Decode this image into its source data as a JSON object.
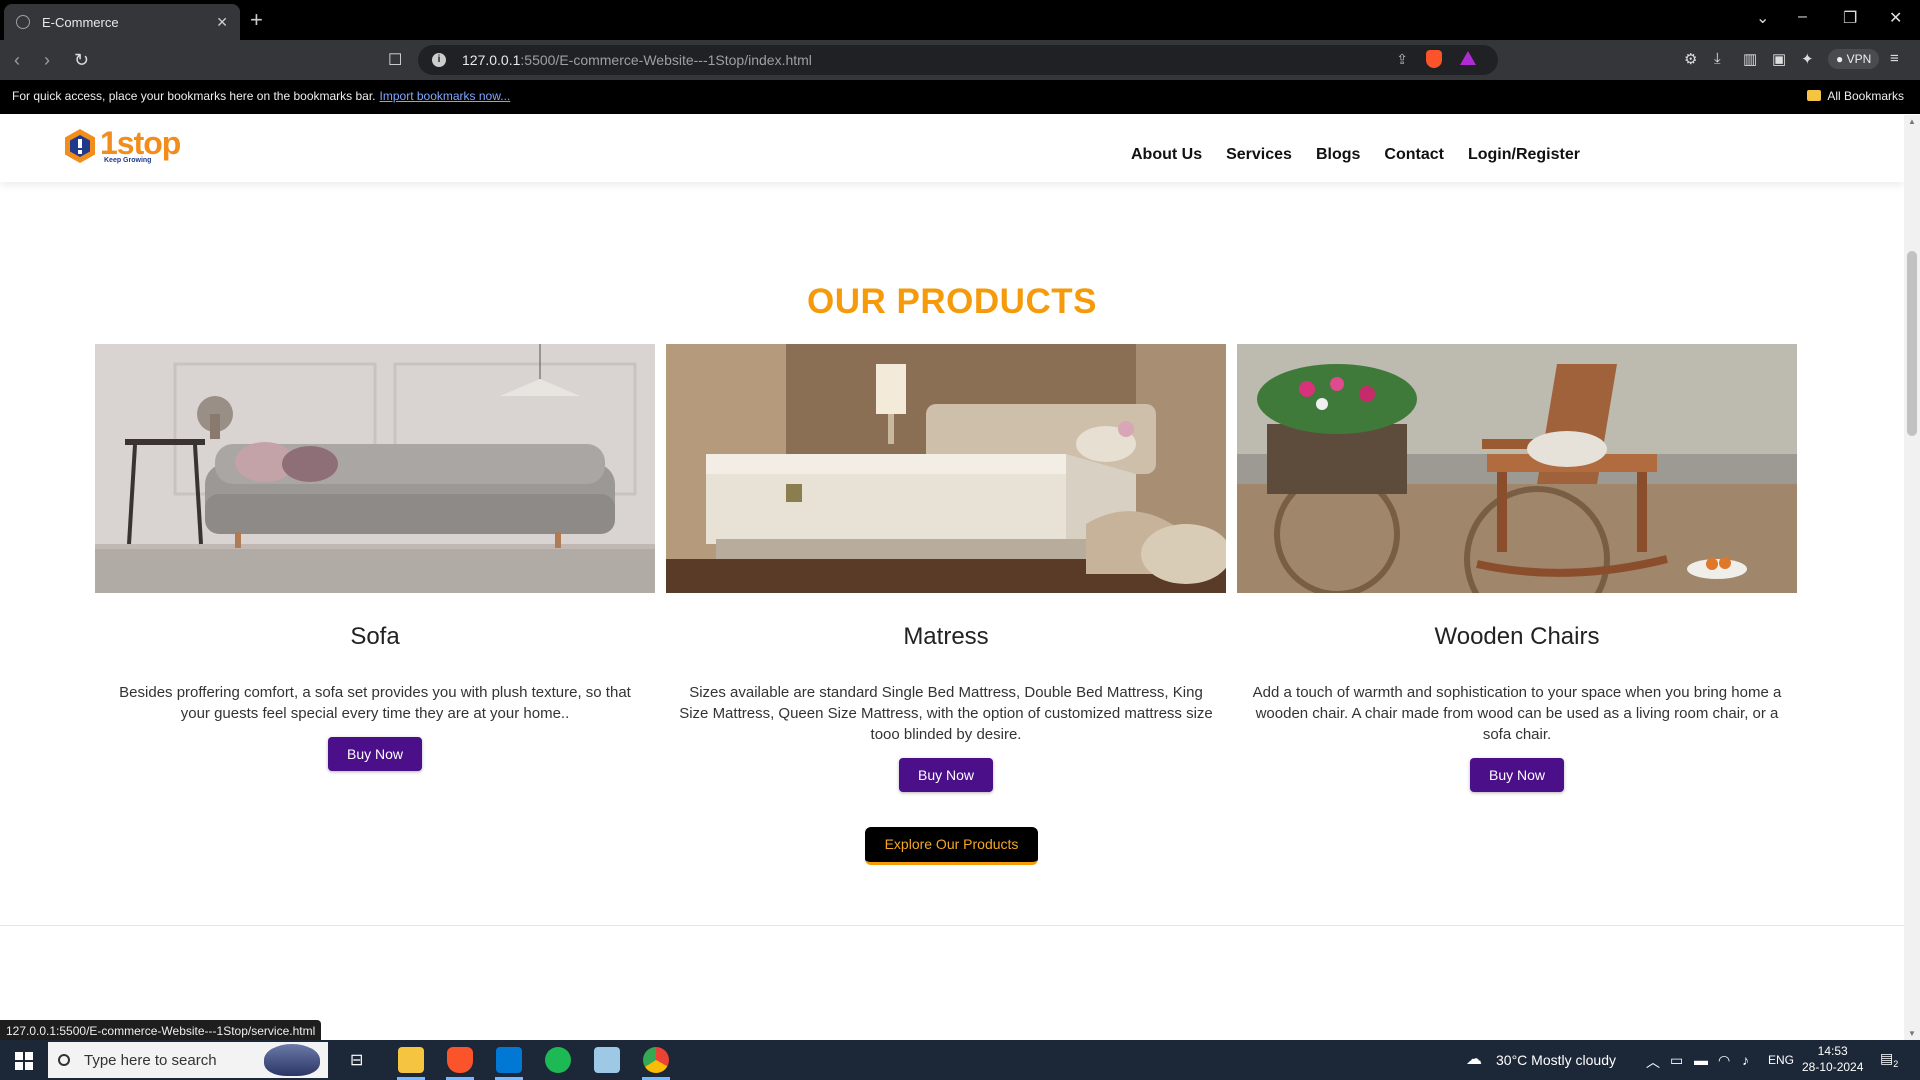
{
  "browser": {
    "tab_title": "E-Commerce",
    "close_glyph": "✕",
    "new_tab_glyph": "+",
    "url_host": "127.0.0.1",
    "url_rest": ":5500/E-commerce-Website---1Stop/index.html",
    "vpn_label": "VPN",
    "bookmarks_message": "For quick access, place your bookmarks here on the bookmarks bar.",
    "import_link": "Import bookmarks now...",
    "all_bookmarks": "All Bookmarks",
    "status_url": "127.0.0.1:5500/E-commerce-Website---1Stop/service.html"
  },
  "site": {
    "logo_text": "1stop",
    "logo_tagline": "Keep Growing",
    "nav": [
      "About Us",
      "Services",
      "Blogs",
      "Contact",
      "Login/Register"
    ],
    "section_title": "OUR PRODUCTS",
    "products": [
      {
        "name": "Sofa",
        "description": "Besides proffering comfort, a sofa set provides you with plush texture, so that your guests feel special every time they are at your home..",
        "button": "Buy Now"
      },
      {
        "name": "Matress",
        "description": "Sizes available are standard Single Bed Mattress, Double Bed Mattress, King Size Mattress, Queen Size Mattress, with the option of customized mattress size tooo blinded by desire.",
        "button": "Buy Now"
      },
      {
        "name": "Wooden Chairs",
        "description": "Add a touch of warmth and sophistication to your space when you bring home a wooden chair. A chair made from wood can be used as a living room chair, or a sofa chair.",
        "button": "Buy Now"
      }
    ],
    "explore_button": "Explore Our Products"
  },
  "taskbar": {
    "search_placeholder": "Type here to search",
    "weather": "30°C  Mostly cloudy",
    "language": "ENG",
    "time": "14:53",
    "date": "28-10-2024",
    "notifications": "2"
  },
  "colors": {
    "accent_orange": "#f59b0b",
    "button_purple": "#4b0f8a"
  }
}
